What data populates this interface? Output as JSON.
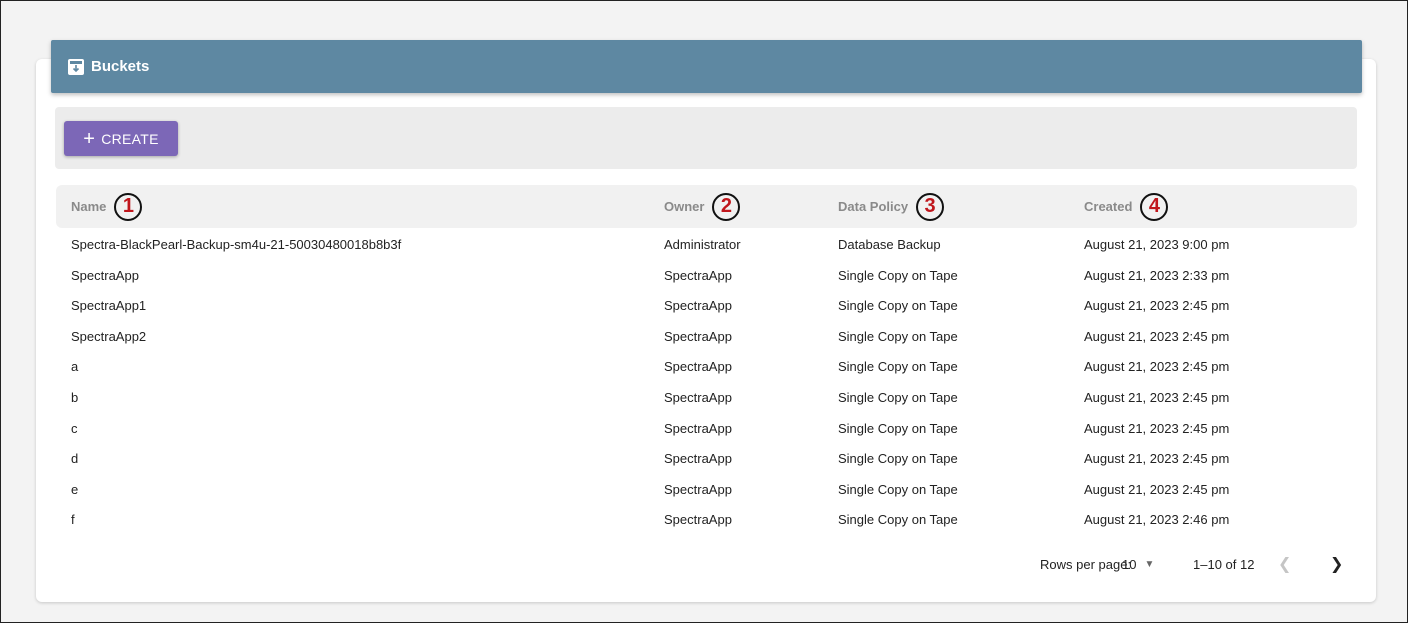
{
  "panel": {
    "title": "Buckets",
    "icon": "archive-icon"
  },
  "toolbar": {
    "create_label": "CREATE",
    "create_icon": "plus-icon"
  },
  "table": {
    "columns": [
      {
        "label": "Name",
        "callout": "1"
      },
      {
        "label": "Owner",
        "callout": "2"
      },
      {
        "label": "Data Policy",
        "callout": "3"
      },
      {
        "label": "Created",
        "callout": "4"
      }
    ],
    "rows": [
      {
        "name": "Spectra-BlackPearl-Backup-sm4u-21-50030480018b8b3f",
        "owner": "Administrator",
        "policy": "Database Backup",
        "created": "August 21, 2023 9:00 pm"
      },
      {
        "name": "SpectraApp",
        "owner": "SpectraApp",
        "policy": "Single Copy on Tape",
        "created": "August 21, 2023 2:33 pm"
      },
      {
        "name": "SpectraApp1",
        "owner": "SpectraApp",
        "policy": "Single Copy on Tape",
        "created": "August 21, 2023 2:45 pm"
      },
      {
        "name": "SpectraApp2",
        "owner": "SpectraApp",
        "policy": "Single Copy on Tape",
        "created": "August 21, 2023 2:45 pm"
      },
      {
        "name": "a",
        "owner": "SpectraApp",
        "policy": "Single Copy on Tape",
        "created": "August 21, 2023 2:45 pm"
      },
      {
        "name": "b",
        "owner": "SpectraApp",
        "policy": "Single Copy on Tape",
        "created": "August 21, 2023 2:45 pm"
      },
      {
        "name": "c",
        "owner": "SpectraApp",
        "policy": "Single Copy on Tape",
        "created": "August 21, 2023 2:45 pm"
      },
      {
        "name": "d",
        "owner": "SpectraApp",
        "policy": "Single Copy on Tape",
        "created": "August 21, 2023 2:45 pm"
      },
      {
        "name": "e",
        "owner": "SpectraApp",
        "policy": "Single Copy on Tape",
        "created": "August 21, 2023 2:45 pm"
      },
      {
        "name": "f",
        "owner": "SpectraApp",
        "policy": "Single Copy on Tape",
        "created": "August 21, 2023 2:46 pm"
      }
    ]
  },
  "pagination": {
    "rows_per_page_label": "Rows per page:",
    "rows_per_page_value": "10",
    "range": "1–10 of 12",
    "prev_icon": "chevron-left-icon",
    "next_icon": "chevron-right-icon"
  },
  "colors": {
    "header_bg": "#5e88a2",
    "create_button": "#7c67b7",
    "callout_number": "#c0161c"
  }
}
